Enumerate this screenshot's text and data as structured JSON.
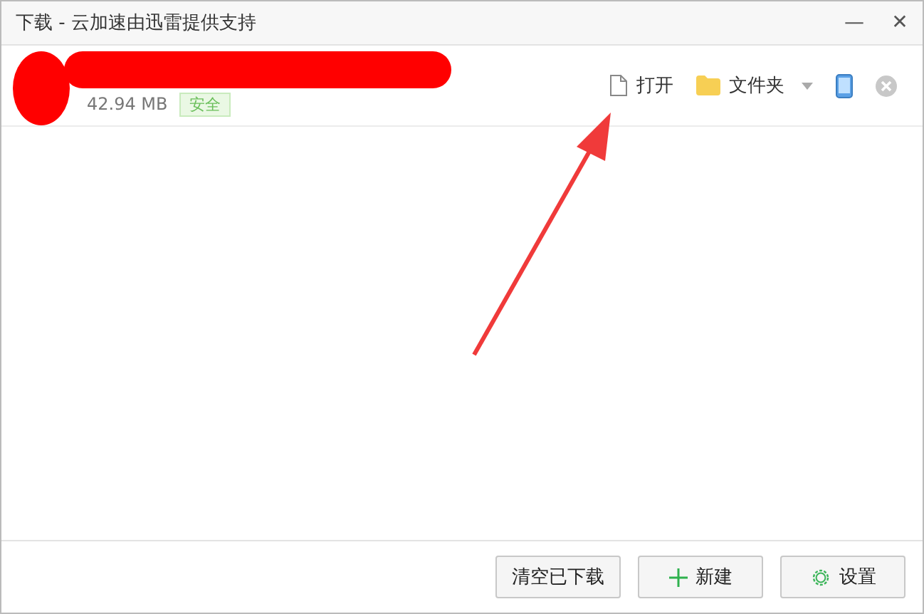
{
  "window": {
    "title": "下载 - 云加速由迅雷提供支持",
    "minimize": "—",
    "close": "✕"
  },
  "download": {
    "size": "42.94 MB",
    "badge": "安全",
    "actions": [
      {
        "kind": "file",
        "label": "打开"
      },
      {
        "kind": "folder",
        "label": "文件夹"
      }
    ]
  },
  "footer_buttons": [
    {
      "kind": "plain",
      "label": "清空已下载"
    },
    {
      "kind": "plus",
      "label": "新建"
    },
    {
      "kind": "gear",
      "label": "设置"
    }
  ]
}
